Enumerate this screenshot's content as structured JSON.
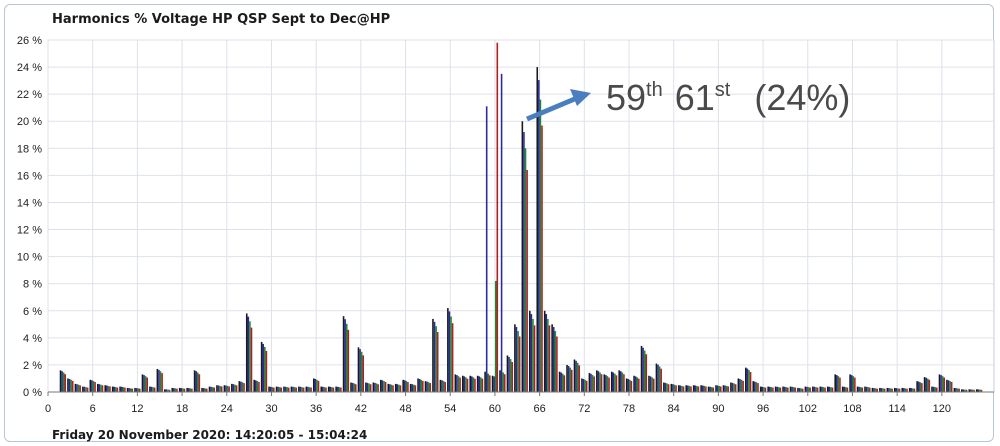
{
  "footer": "Friday 20 November 2020: 14:20:05 - 15:04:24",
  "colors": {
    "series": [
      "#1a1a1a",
      "#2a2aa0",
      "#1e8a2e",
      "#b02020"
    ],
    "grid": "#dde2ea",
    "annotation_arrow": "#4a7ebf"
  },
  "annotation": {
    "base1": "59",
    "sup1": "th",
    "base2": "61",
    "sup2": "st",
    "value": "(24%)"
  },
  "chart_data": {
    "type": "bar",
    "title": "Harmonics % Voltage HP QSP Sept to Dec@HP",
    "xlabel": "",
    "ylabel": "",
    "x_range": [
      0,
      127
    ],
    "ylim": [
      0,
      26
    ],
    "y_ticks": [
      0,
      2,
      4,
      6,
      8,
      10,
      12,
      14,
      16,
      18,
      20,
      22,
      24,
      26
    ],
    "y_tick_labels": [
      "0 %",
      "2 %",
      "4 %",
      "6 %",
      "8 %",
      "10 %",
      "12 %",
      "14 %",
      "16 %",
      "18 %",
      "20 %",
      "22 %",
      "24 %",
      "26 %"
    ],
    "x_ticks": [
      0,
      6,
      12,
      18,
      24,
      30,
      36,
      42,
      48,
      54,
      60,
      66,
      72,
      78,
      84,
      90,
      96,
      102,
      108,
      114,
      120
    ],
    "grid": true,
    "series_per_harmonic": 4,
    "harmonics": [
      2,
      3,
      4,
      5,
      6,
      7,
      8,
      9,
      10,
      11,
      12,
      13,
      14,
      15,
      16,
      17,
      18,
      19,
      20,
      21,
      22,
      23,
      24,
      25,
      26,
      27,
      28,
      29,
      30,
      31,
      32,
      33,
      34,
      35,
      36,
      37,
      38,
      39,
      40,
      41,
      42,
      43,
      44,
      45,
      46,
      47,
      48,
      49,
      50,
      51,
      52,
      53,
      54,
      55,
      56,
      57,
      58,
      59,
      60,
      61,
      62,
      63,
      64,
      65,
      66,
      67,
      68,
      69,
      70,
      71,
      72,
      73,
      74,
      75,
      76,
      77,
      78,
      79,
      80,
      81,
      82,
      83,
      84,
      85,
      86,
      87,
      88,
      89,
      90,
      91,
      92,
      93,
      94,
      95,
      96,
      97,
      98,
      99,
      100,
      101,
      102,
      103,
      104,
      105,
      106,
      107,
      108,
      109,
      110,
      111,
      112,
      113,
      114,
      115,
      116,
      117,
      118,
      119,
      120,
      121,
      122,
      123,
      124,
      125
    ],
    "values": [
      1.6,
      1.0,
      0.6,
      0.4,
      0.9,
      0.6,
      0.5,
      0.4,
      0.4,
      0.3,
      0.3,
      1.3,
      0.4,
      1.7,
      0.2,
      0.3,
      0.3,
      0.3,
      1.6,
      0.3,
      0.4,
      0.5,
      0.5,
      0.6,
      0.8,
      5.8,
      0.9,
      3.7,
      0.4,
      0.4,
      0.4,
      0.4,
      0.4,
      0.4,
      1.0,
      0.4,
      0.4,
      0.4,
      5.6,
      0.7,
      3.3,
      0.7,
      0.7,
      0.9,
      0.6,
      0.6,
      0.9,
      0.6,
      1.0,
      0.8,
      5.4,
      0.9,
      6.2,
      1.3,
      1.2,
      1.2,
      1.2,
      1.5,
      1.2,
      1.6,
      2.7,
      5.0,
      20.0,
      6.0,
      24.0,
      6.0,
      5.0,
      1.5,
      2.0,
      2.4,
      1.0,
      1.4,
      1.6,
      1.3,
      1.5,
      1.6,
      1.0,
      1.2,
      3.4,
      1.2,
      2.1,
      0.7,
      0.6,
      0.5,
      0.5,
      0.5,
      0.5,
      0.4,
      0.5,
      0.5,
      0.7,
      1.0,
      1.8,
      0.8,
      0.4,
      0.4,
      0.4,
      0.4,
      0.4,
      0.3,
      0.4,
      0.4,
      0.4,
      0.4,
      1.3,
      0.4,
      1.3,
      0.4,
      0.4,
      0.3,
      0.3,
      0.3,
      0.3,
      0.3,
      0.3,
      0.8,
      1.1,
      0.4,
      1.3,
      0.9,
      0.3,
      0.2,
      0.2,
      0.2
    ],
    "overrides": [
      {
        "h": 59,
        "series": 1,
        "value": 21.1
      },
      {
        "h": 61,
        "series": 1,
        "value": 23.5
      },
      {
        "h": 60,
        "series": 3,
        "value": 25.8
      },
      {
        "h": 60,
        "series": 2,
        "value": 8.2
      }
    ]
  }
}
